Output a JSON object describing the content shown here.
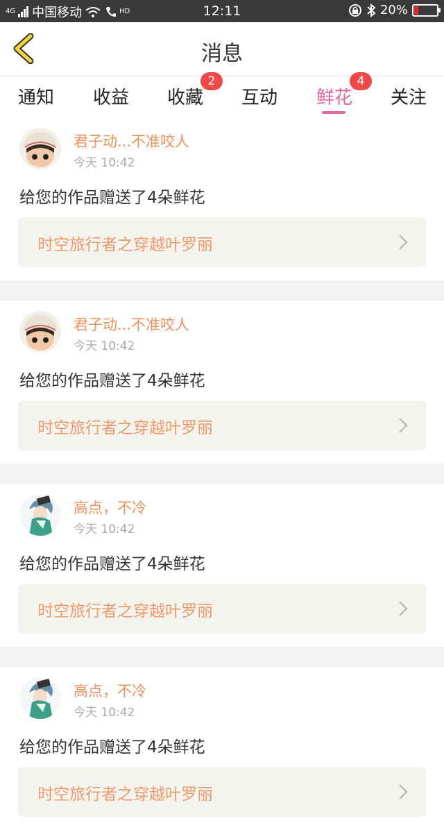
{
  "status": {
    "network": "4G",
    "carrier": "中国移动",
    "hd": "HD",
    "time": "12:11",
    "battery_percent": "20%",
    "battery_level": 0.2
  },
  "nav": {
    "title": "消息",
    "back_icon": "chevron-left-icon"
  },
  "tabs": [
    {
      "label": "通知",
      "badge": ""
    },
    {
      "label": "收益",
      "badge": ""
    },
    {
      "label": "收藏",
      "badge": "2"
    },
    {
      "label": "互动",
      "badge": ""
    },
    {
      "label": "鲜花",
      "badge": "4"
    },
    {
      "label": "关注",
      "badge": ""
    }
  ],
  "active_tab": 4,
  "colors": {
    "accent": "#e5679c",
    "name": "#ee8f5c",
    "badge": "#f04848",
    "card_bg": "#f4f4ef"
  },
  "messages": [
    {
      "user": "君子动...不准咬人",
      "time": "今天 10:42",
      "text": "给您的作品赠送了4朵鲜花",
      "work": "时空旅行者之穿越叶罗丽",
      "avatar": "doll-girl"
    },
    {
      "user": "君子动...不准咬人",
      "time": "今天 10:42",
      "text": "给您的作品赠送了4朵鲜花",
      "work": "时空旅行者之穿越叶罗丽",
      "avatar": "doll-girl"
    },
    {
      "user": "高点，不冷",
      "time": "今天 10:42",
      "text": "给您的作品赠送了4朵鲜花",
      "work": "时空旅行者之穿越叶罗丽",
      "avatar": "anime-boy"
    },
    {
      "user": "高点，不冷",
      "time": "今天 10:42",
      "text": "给您的作品赠送了4朵鲜花",
      "work": "时空旅行者之穿越叶罗丽",
      "avatar": "anime-boy"
    }
  ]
}
